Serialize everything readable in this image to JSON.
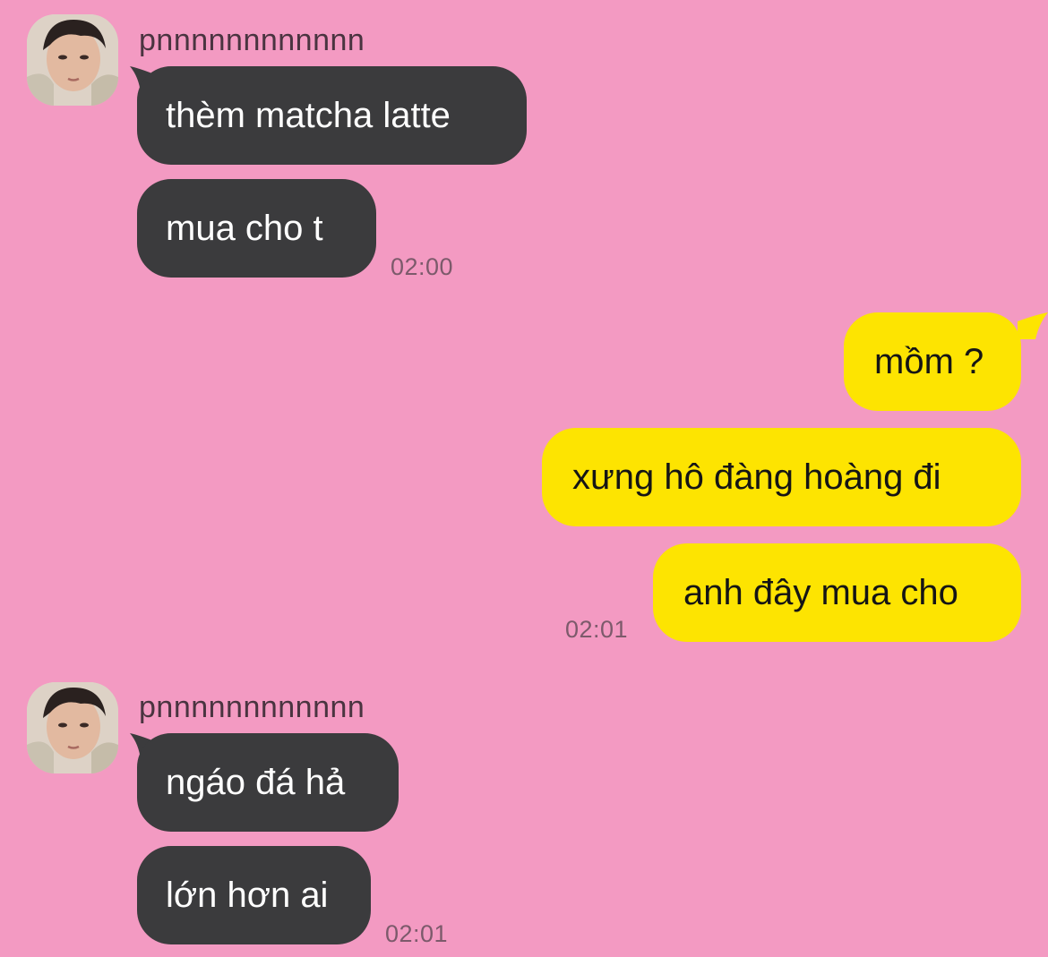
{
  "chat": {
    "background_color": "#f39ac2",
    "incoming_bubble_color": "#3b3b3d",
    "outgoing_bubble_color": "#fde401",
    "groups": [
      {
        "direction": "incoming",
        "sender": "pnnnnnnnnnnnn",
        "avatar_icon": "user-photo-avatar",
        "messages": [
          "thèm matcha latte",
          "mua cho t"
        ],
        "time": "02:00"
      },
      {
        "direction": "outgoing",
        "messages": [
          "mồm ?",
          "xưng hô đàng hoàng đi",
          "anh đây mua cho"
        ],
        "time": "02:01"
      },
      {
        "direction": "incoming",
        "sender": "pnnnnnnnnnnnn",
        "avatar_icon": "user-photo-avatar",
        "messages": [
          "ngáo đá hả",
          "lớn hơn ai"
        ],
        "time": "02:01"
      }
    ]
  }
}
